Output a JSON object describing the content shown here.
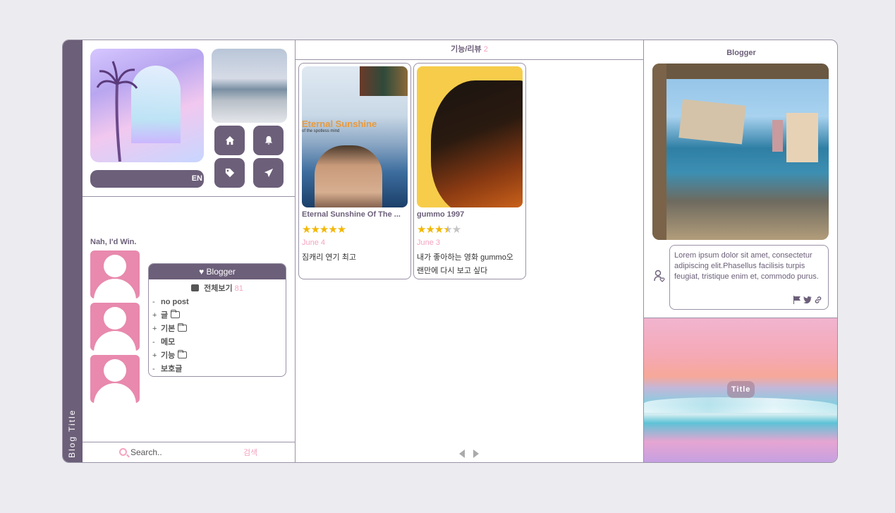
{
  "blog": {
    "title": "Blog Title"
  },
  "left": {
    "lang": "EN",
    "tagline": "Nah, I'd Win.",
    "category": {
      "header": "Blogger",
      "all_label": "전체보기",
      "all_count": "81",
      "items": [
        {
          "mark": "-",
          "name": "no post",
          "folder": false
        },
        {
          "mark": "+",
          "name": "글",
          "folder": true
        },
        {
          "mark": "+",
          "name": "기본",
          "folder": true
        },
        {
          "mark": "-",
          "name": "메모",
          "folder": false
        },
        {
          "mark": "+",
          "name": "기능",
          "folder": true
        },
        {
          "mark": "-",
          "name": "보호글",
          "folder": false
        }
      ]
    },
    "search": {
      "placeholder": "Search..",
      "button": "검색"
    }
  },
  "middle": {
    "header": "기능/리뷰",
    "header_count": "2",
    "posts": [
      {
        "poster_title": "Eternal Sunshine",
        "poster_subtitle": "of the spotless mind",
        "title": "Eternal Sunshine Of The ...",
        "rating": 5,
        "date": "June 4",
        "text": "짐캐리 연기 최고"
      },
      {
        "title": "gummo 1997",
        "rating": 3.5,
        "date": "June 3",
        "text": "내가 좋아하는 영화 gummo오 랜만에 다시 보고 싶다"
      }
    ]
  },
  "right": {
    "header": "Blogger",
    "bio": "Lorem ipsum dolor sit amet, consectetur adipiscing elit.Phasellus facilisis turpis feugiat, tristique enim et, commodo purus.",
    "banner_title": "Title"
  },
  "colors": {
    "accent": "#6c5f79",
    "pink": "#f4a4c0",
    "star": "#f2b705",
    "avatar": "#e889ad"
  }
}
